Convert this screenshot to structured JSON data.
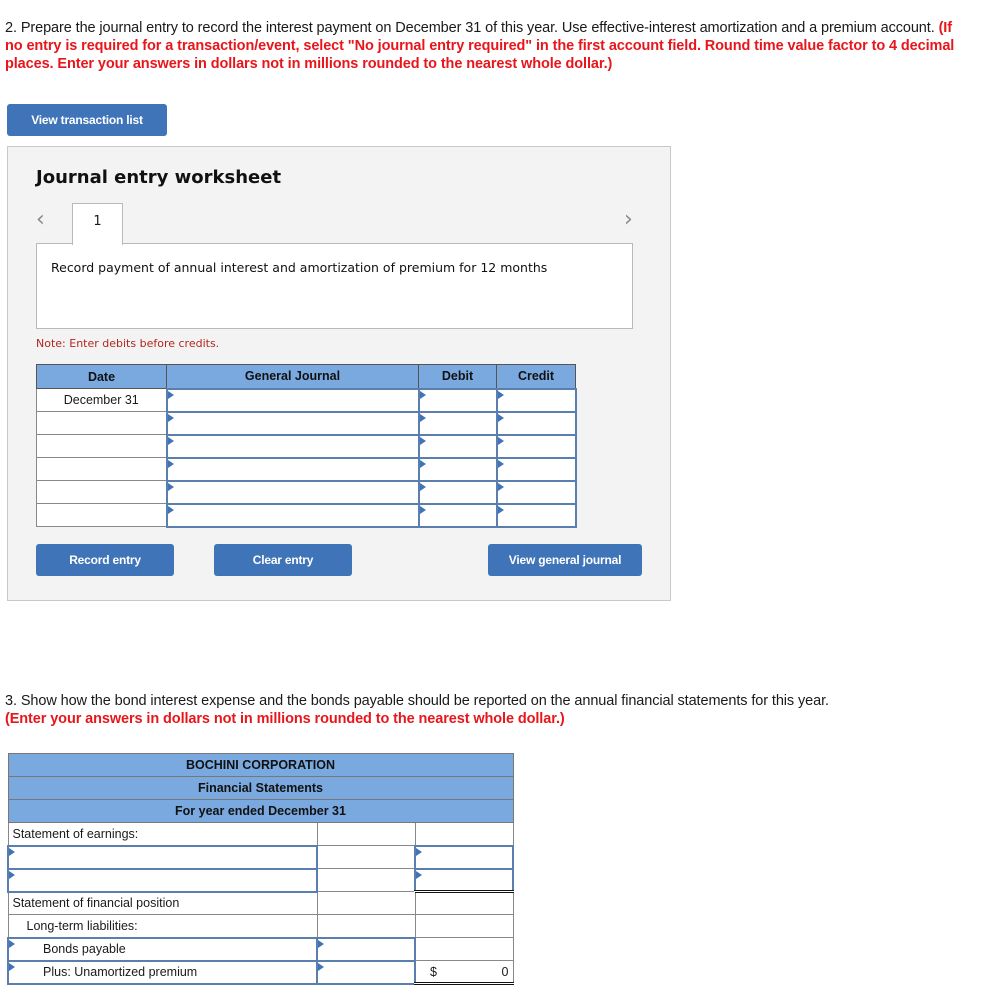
{
  "question2": {
    "text": "2. Prepare the journal entry to record the interest payment on December 31 of this year. Use effective-interest amortization and a premium account. ",
    "instruction": "(If no entry is required for a transaction/event, select \"No journal entry required\" in the first account field. Round time value factor to 4 decimal places. Enter your answers in dollars not in millions rounded to the nearest whole dollar.)"
  },
  "view_transaction_list_label": "View transaction list",
  "worksheet": {
    "title": "Journal entry worksheet",
    "prev_icon": "‹",
    "next_icon": "›",
    "tab_label": "1",
    "description": "Record payment of annual interest and amortization of premium for 12 months",
    "note": "Note: Enter debits before credits.",
    "columns": [
      "Date",
      "General Journal",
      "Debit",
      "Credit"
    ],
    "rows": [
      {
        "date": "December 31",
        "account": "",
        "debit": "",
        "credit": ""
      },
      {
        "date": "",
        "account": "",
        "debit": "",
        "credit": ""
      },
      {
        "date": "",
        "account": "",
        "debit": "",
        "credit": ""
      },
      {
        "date": "",
        "account": "",
        "debit": "",
        "credit": ""
      },
      {
        "date": "",
        "account": "",
        "debit": "",
        "credit": ""
      },
      {
        "date": "",
        "account": "",
        "debit": "",
        "credit": ""
      }
    ],
    "record_label": "Record entry",
    "clear_label": "Clear entry",
    "view_journal_label": "View general journal"
  },
  "question3": {
    "text": "3. Show how the bond interest expense and the bonds payable should be reported on the annual financial statements for this year.",
    "instruction": "(Enter your answers in dollars not in millions rounded to the nearest whole dollar.)"
  },
  "financial_statements": {
    "company": "BOCHINI CORPORATION",
    "title": "Financial Statements",
    "period": "For year ended December 31",
    "earnings_label": "Statement of earnings:",
    "position_label": "Statement of financial position",
    "liabilities_label": "Long-term liabilities:",
    "bonds_payable_label": "Bonds payable",
    "premium_label": "Plus: Unamortized premium",
    "currency_symbol": "$",
    "total_value": "0"
  }
}
